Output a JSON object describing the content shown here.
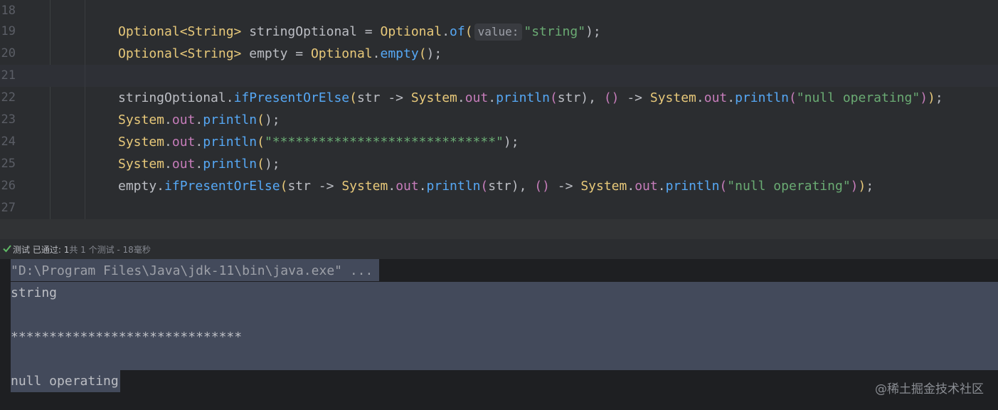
{
  "editor": {
    "lines": [
      {
        "num": "18"
      },
      {
        "num": "19",
        "t": [
          "Optional",
          "<String>",
          " stringOptional = ",
          "Optional",
          ".",
          "of",
          "(",
          "value:",
          "\"string\"",
          ");"
        ]
      },
      {
        "num": "20",
        "t": [
          "Optional",
          "<String>",
          " empty = ",
          "Optional",
          ".",
          "empty",
          "(",
          ");"
        ]
      },
      {
        "num": "21"
      },
      {
        "num": "22",
        "t": [
          "stringOptional.",
          "ifPresentOrElse",
          "(",
          "str",
          " -> ",
          "System",
          ".",
          "out",
          ".",
          "println",
          "(",
          "str",
          "), ",
          "()",
          " -> ",
          "System",
          ".",
          "out",
          ".",
          "println",
          "(",
          "\"null operating\"",
          ")",
          ")",
          ";"
        ]
      },
      {
        "num": "23",
        "t": [
          "System",
          ".",
          "out",
          ".",
          "println",
          "(",
          ");"
        ]
      },
      {
        "num": "24",
        "t": [
          "System",
          ".",
          "out",
          ".",
          "println",
          "(",
          "\"*****************************\"",
          ");"
        ]
      },
      {
        "num": "25",
        "t": [
          "System",
          ".",
          "out",
          ".",
          "println",
          "(",
          ");"
        ]
      },
      {
        "num": "26",
        "t": [
          "empty.",
          "ifPresentOrElse",
          "(",
          "str",
          " -> ",
          "System",
          ".",
          "out",
          ".",
          "println",
          "(",
          "str",
          "), ",
          "()",
          " -> ",
          "System",
          ".",
          "out",
          ".",
          "println",
          "(",
          "\"null operating\"",
          ")",
          ")",
          ";"
        ]
      },
      {
        "num": "27"
      }
    ]
  },
  "test_status": {
    "label": "测试 已通过:",
    "passed": "1",
    "detail": "共 1 个测试 - 18毫秒"
  },
  "console": {
    "command": "\"D:\\Program Files\\Java\\jdk-11\\bin\\java.exe\" ...",
    "lines": [
      "string",
      "",
      "******************************",
      "",
      "null operating"
    ]
  },
  "watermark": "@稀土掘金技术社区",
  "colors": {
    "editor_bg": "#2b2d30",
    "console_bg": "#1e1f22",
    "keyword_type": "#e8c97a",
    "method": "#56a8f5",
    "field": "#c77dbb",
    "string": "#6aab73",
    "selection": "#434a5b",
    "pass_check": "#5fb865"
  }
}
